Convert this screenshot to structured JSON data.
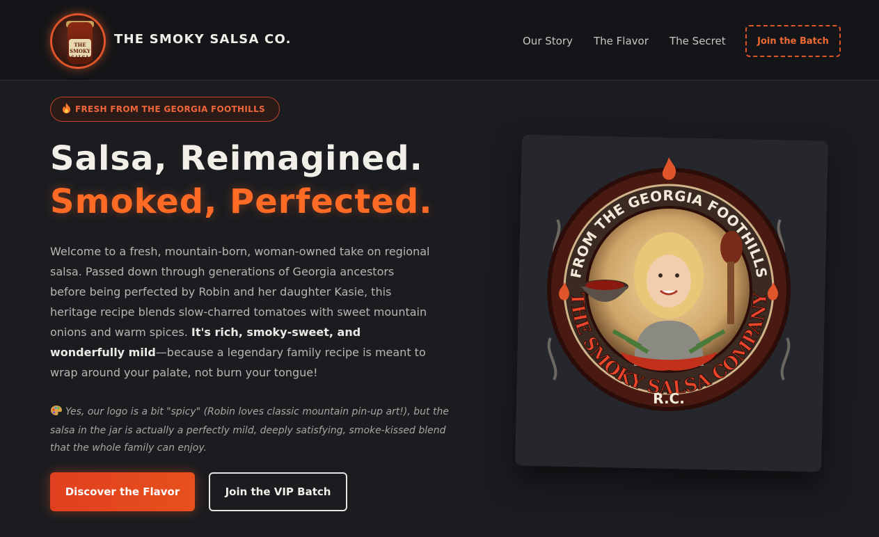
{
  "header": {
    "brand_name": "THE SMOKY SALSA CO.",
    "logo_label_line1": "THE",
    "logo_label_line2": "SMOKY",
    "logo_label_line3": "SALSA",
    "nav": [
      {
        "label": "Our Story"
      },
      {
        "label": "The Flavor"
      },
      {
        "label": "The Secret"
      }
    ],
    "cta_label": "Join the Batch"
  },
  "hero": {
    "badge_icon": "fire-icon",
    "badge_text": "FRESH FROM THE GEORGIA FOOTHILLS",
    "headline_line1": "Salsa, Reimagined.",
    "headline_line2": "Smoked, Perfected.",
    "intro_part1": "Welcome to a fresh, mountain-born, woman-owned take on regional salsa. Passed down through generations of Georgia ancestors before being perfected by Robin and her daughter Kasie, this heritage recipe blends slow-charred tomatoes with sweet mountain onions and warm spices. ",
    "intro_bold": "It's rich, smoky-sweet, and wonderfully mild",
    "intro_part2": "—because a legendary family recipe is meant to wrap around your palate, not burn your tongue!",
    "note_icon": "palette-icon",
    "note_text": "Yes, our logo is a bit \"spicy\" (Robin loves classic mountain pin-up art!), but the salsa in the jar is actually a perfectly mild, deeply satisfying, smoke-kissed blend that the whole family can enjoy.",
    "primary_button": "Discover the Flavor",
    "secondary_button": "Join the VIP Batch"
  },
  "emblem": {
    "arc_top": "FROM THE GEORGIA FOOTHILLS",
    "arc_bottom": "THE SMOKY SALSA COMPANY",
    "initials": "R.C."
  },
  "colors": {
    "accent": "#ff6a24",
    "accent_dark": "#e0401f",
    "background": "#1b1c20",
    "header_bg": "#141518"
  }
}
